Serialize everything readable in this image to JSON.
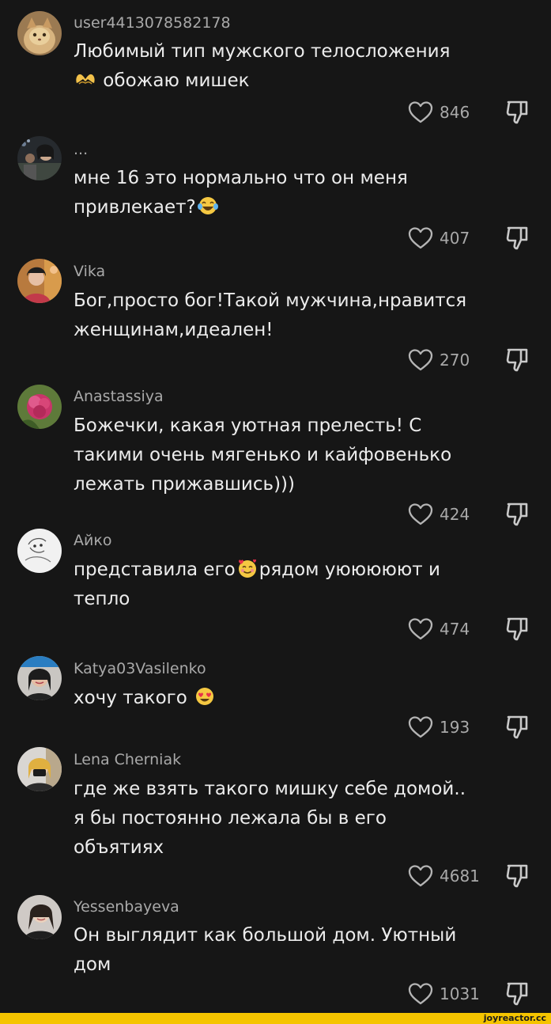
{
  "comments": [
    {
      "username": "user4413078582178",
      "text_parts": [
        "Любимый тип мужского телосложения\n",
        " обожаю мишек"
      ],
      "emoji": "heart-hands-emoji",
      "likes": "846",
      "avatar": "cat-avatar"
    },
    {
      "username": "...",
      "text_parts": [
        "мне 16 это нормально что он меня\nпривлекает?",
        ""
      ],
      "emoji": "tears-of-joy-emoji",
      "likes": "407",
      "avatar": "photo-avatar"
    },
    {
      "username": "Vika",
      "text_parts": [
        "Бог,просто бог!Такой мужчина,нравится\nженщинам,идеален!",
        ""
      ],
      "emoji": "",
      "likes": "270",
      "avatar": "photo-avatar"
    },
    {
      "username": "Anastassiya",
      "text_parts": [
        "Божечки, какая уютная прелесть! С\nтакими очень мягенько и кайфовенько\nлежать прижавшись)))",
        ""
      ],
      "emoji": "",
      "likes": "424",
      "avatar": "flower-avatar"
    },
    {
      "username": "Айко",
      "text_parts": [
        "представила его",
        "рядом уююююют и\nтепло"
      ],
      "emoji": "smiling-hearts-emoji",
      "likes": "474",
      "avatar": "drawing-avatar"
    },
    {
      "username": "Katya03Vasilenko",
      "text_parts": [
        "хочу такого ",
        ""
      ],
      "emoji": "heart-eyes-emoji",
      "likes": "193",
      "avatar": "photo-avatar"
    },
    {
      "username": "Lena Cherniak",
      "text_parts": [
        "где же взять такого мишку себе домой..\nя бы постоянно лежала бы в его\nобъятиях",
        ""
      ],
      "emoji": "",
      "likes": "4681",
      "avatar": "photo-avatar"
    },
    {
      "username": "Yessenbayeva",
      "text_parts": [
        "Он выглядит как большой дом. Уютный\nдом",
        ""
      ],
      "emoji": "",
      "likes": "1031",
      "avatar": "photo-avatar"
    }
  ],
  "watermark": "joyreactor.cc",
  "colors": {
    "background": "#161616",
    "text": "#ececec",
    "muted": "#a9a9a9",
    "watermark_bar": "#f5c400"
  }
}
